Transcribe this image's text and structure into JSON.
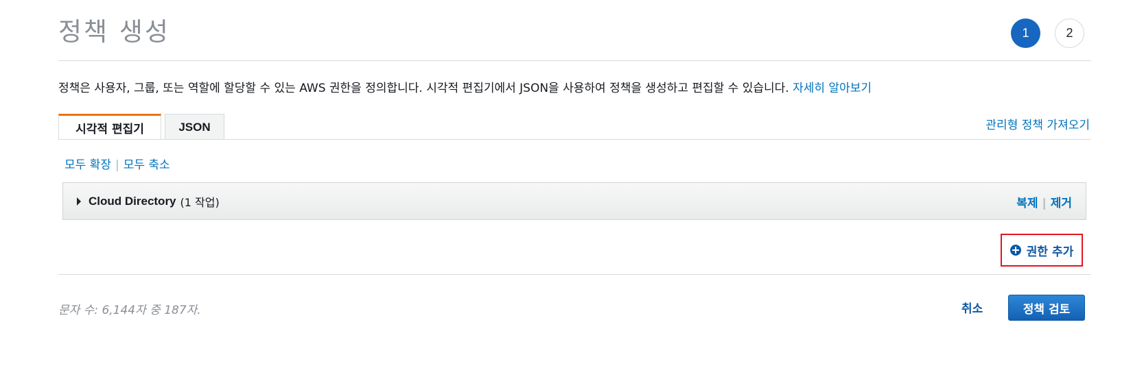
{
  "header": {
    "title": "정책 생성",
    "steps": [
      {
        "label": "1",
        "active": true
      },
      {
        "label": "2",
        "active": false
      }
    ]
  },
  "description": {
    "text": "정책은 사용자, 그룹, 또는 역할에 할당할 수 있는 AWS 권한을 정의합니다. 시각적 편집기에서 JSON을 사용하여 정책을 생성하고 편집할 수 있습니다. ",
    "learn_more": "자세히 알아보기"
  },
  "tabs": [
    {
      "label": "시각적 편집기",
      "active": true
    },
    {
      "label": "JSON",
      "active": false
    }
  ],
  "import_managed_policy": "관리형 정책 가져오기",
  "expand_controls": {
    "expand_all": "모두 확장",
    "collapse_all": "모두 축소",
    "separator": "|"
  },
  "service_panel": {
    "service_name": "Cloud Directory",
    "action_count": "(1 작업)",
    "duplicate": "복제",
    "remove": "제거",
    "separator": "|"
  },
  "add_permissions": "권한 추가",
  "footer": {
    "char_count": "문자 수: 6,144자 중 187자.",
    "cancel": "취소",
    "review": "정책 검토"
  },
  "colors": {
    "accent": "#0d58a3",
    "link": "#0073bb",
    "tab_active_border": "#ec7211",
    "highlight_box": "#e0161f",
    "step_active": "#1766c0"
  },
  "icons": {
    "expand_caret": "caret-right-icon",
    "add": "plus-circle-icon"
  }
}
